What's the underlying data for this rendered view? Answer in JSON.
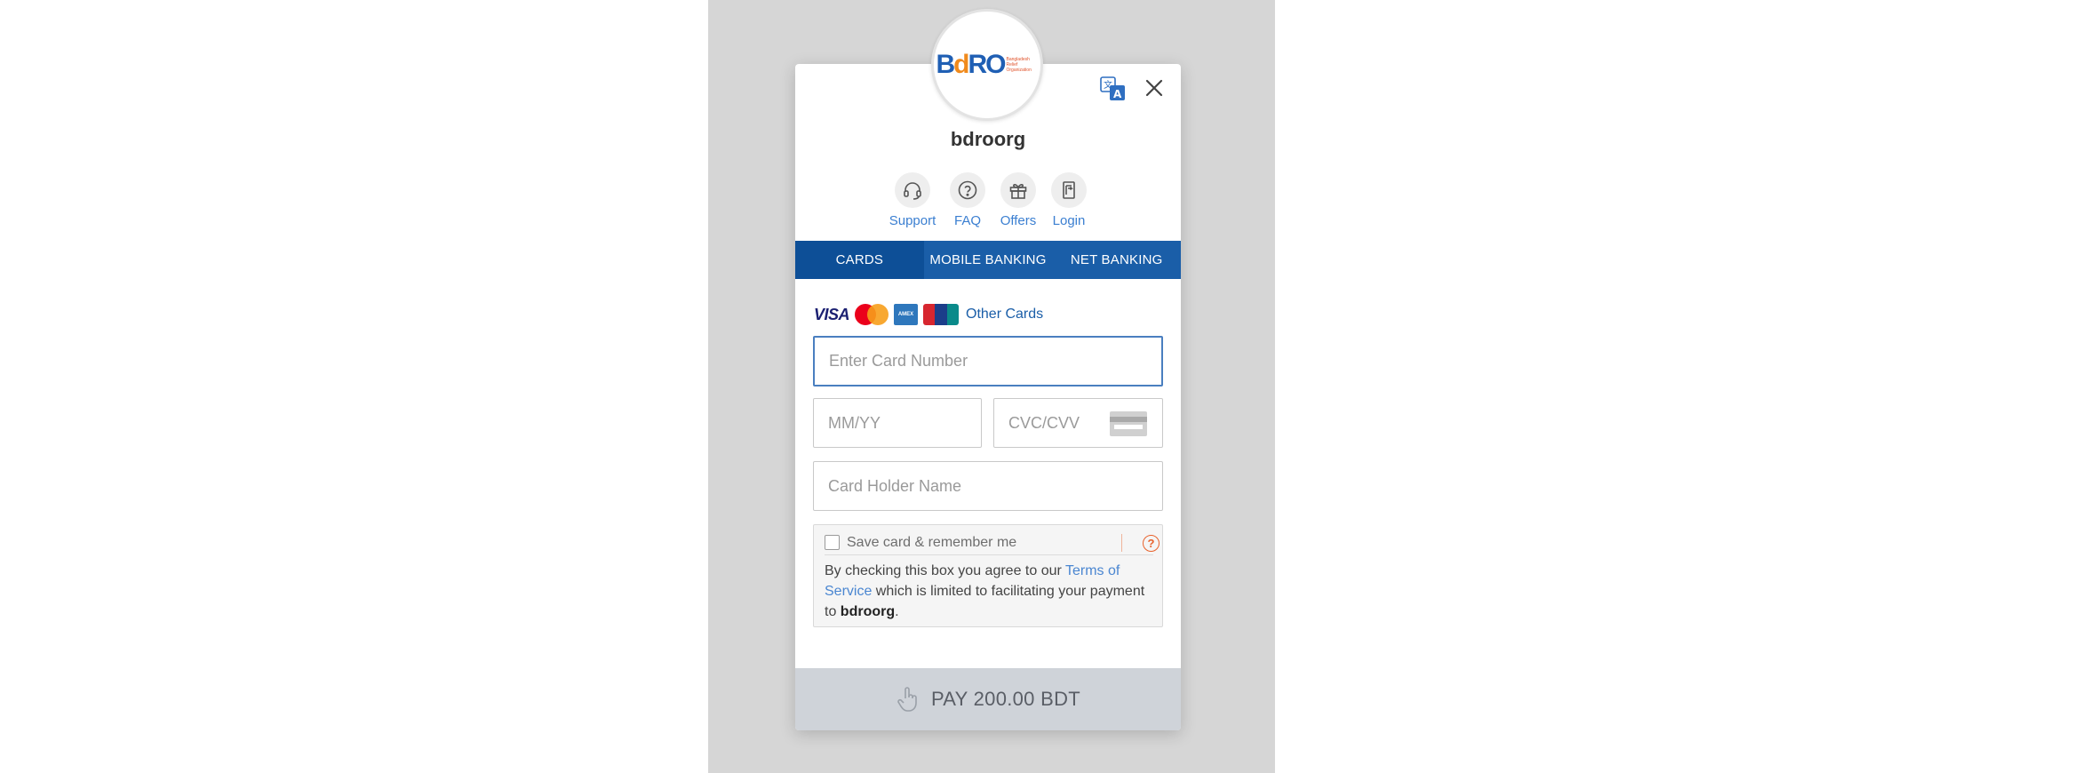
{
  "logo": {
    "brand_text": "BdRO",
    "sub_text": "Bangladesh Relief Organization"
  },
  "merchant": {
    "name": "bdroorg"
  },
  "quick_links": [
    {
      "id": "support",
      "label": "Support",
      "icon": "headset-icon"
    },
    {
      "id": "faq",
      "label": "FAQ",
      "icon": "question-icon"
    },
    {
      "id": "offers",
      "label": "Offers",
      "icon": "gift-icon"
    },
    {
      "id": "login",
      "label": "Login",
      "icon": "login-icon"
    }
  ],
  "tabs": [
    {
      "id": "cards",
      "label": "CARDS",
      "active": true
    },
    {
      "id": "mobile-banking",
      "label": "MOBILE BANKING",
      "active": false
    },
    {
      "id": "net-banking",
      "label": "NET BANKING",
      "active": false
    }
  ],
  "card_brands": {
    "visa": "VISA",
    "amex": "AMEX",
    "unionpay": "UnionPay",
    "other_cards": "Other Cards"
  },
  "form": {
    "card_number_placeholder": "Enter Card Number",
    "expiry_placeholder": "MM/YY",
    "cvc_placeholder": "CVC/CVV",
    "holder_placeholder": "Card Holder Name"
  },
  "save_card": {
    "label": "Save card & remember me",
    "checked": false,
    "help": "?",
    "terms_prefix": "By checking this box you agree to our ",
    "terms_link": "Terms of Service",
    "terms_middle": " which is limited to facilitating your payment to ",
    "terms_merchant": "bdroorg",
    "terms_suffix": "."
  },
  "pay": {
    "label": "PAY 200.00 BDT"
  },
  "colors": {
    "tab_bar": "#1a5ea8",
    "tab_active": "#0d4f97",
    "link": "#3b7fd1",
    "pay_bar": "#cfd3d9",
    "help_accent": "#e8622c"
  }
}
